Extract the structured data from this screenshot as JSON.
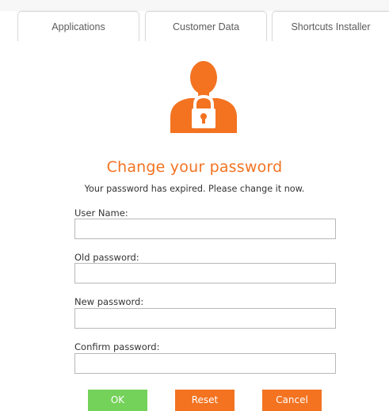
{
  "tabs": [
    {
      "label": "Applications"
    },
    {
      "label": "Customer Data"
    },
    {
      "label": "Shortcuts Installer"
    }
  ],
  "header": {
    "icon": "user-lock-icon",
    "title": "Change your password",
    "subtitle": "Your password has expired. Please change it now."
  },
  "form": {
    "username_label": "User Name:",
    "username_value": "",
    "old_password_label": "Old password:",
    "old_password_value": "",
    "new_password_label": "New password:",
    "new_password_value": "",
    "confirm_password_label": "Confirm password:",
    "confirm_password_value": ""
  },
  "buttons": {
    "ok_label": "OK",
    "reset_label": "Reset",
    "cancel_label": "Cancel"
  },
  "colors": {
    "accent": "#f37321",
    "ok_green": "#74d159",
    "text": "#333333"
  }
}
